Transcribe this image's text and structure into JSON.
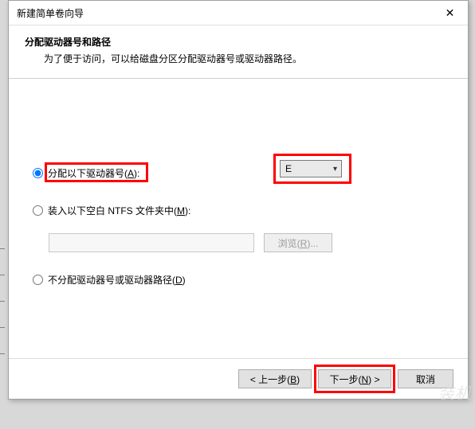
{
  "window": {
    "title": "新建简单卷向导",
    "close_glyph": "✕"
  },
  "header": {
    "title": "分配驱动器号和路径",
    "description": "为了便于访问，可以给磁盘分区分配驱动器号或驱动器路径。"
  },
  "options": {
    "assign_letter": {
      "label_pre": "分配以下驱动器号(",
      "hotkey": "A",
      "label_post": "):",
      "selected": true
    },
    "mount_folder": {
      "label_pre": "装入以下空白 NTFS 文件夹中(",
      "hotkey": "M",
      "label_post": "):",
      "selected": false
    },
    "no_assign": {
      "label_pre": "不分配驱动器号或驱动器路径(",
      "hotkey": "D",
      "label_post": ")",
      "selected": false
    }
  },
  "drive_letter": {
    "value": "E"
  },
  "folder": {
    "path": "",
    "browse_pre": "浏览(",
    "browse_hotkey": "R",
    "browse_post": ")..."
  },
  "footer": {
    "back_pre": "< 上一步(",
    "back_hotkey": "B",
    "back_post": ")",
    "next_pre": "下一步(",
    "next_hotkey": "N",
    "next_post": ") >",
    "cancel": "取消"
  },
  "watermark": "装机"
}
